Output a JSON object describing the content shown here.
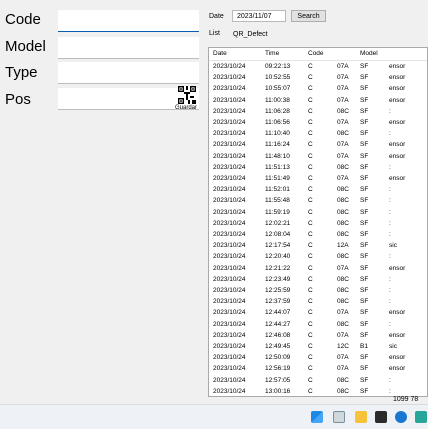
{
  "form": {
    "code_label": "Code",
    "model_label": "Model",
    "type_label": "Type",
    "pos_label": "Pos",
    "qr_caption": "Guardar"
  },
  "filter": {
    "date_label": "Date",
    "date_value": "2023/11/07",
    "search_label": "Search",
    "list_label": "List",
    "list_value": "QR_Defect"
  },
  "table": {
    "columns": [
      "Date",
      "Time",
      "Code",
      "Model"
    ],
    "rows": [
      [
        "2023/10/24",
        "09:22:13",
        "C",
        "07A",
        "SF",
        "ensor"
      ],
      [
        "2023/10/24",
        "10:52:55",
        "C",
        "07A",
        "SF",
        "ensor"
      ],
      [
        "2023/10/24",
        "10:55:07",
        "C",
        "07A",
        "SF",
        "ensor"
      ],
      [
        "2023/10/24",
        "11:00:38",
        "C",
        "07A",
        "SF",
        "ensor"
      ],
      [
        "2023/10/24",
        "11:06:28",
        "C",
        "08C",
        "SF",
        ":"
      ],
      [
        "2023/10/24",
        "11:06:56",
        "C",
        "07A",
        "SF",
        "ensor"
      ],
      [
        "2023/10/24",
        "11:10:40",
        "C",
        "08C",
        "SF",
        ":"
      ],
      [
        "2023/10/24",
        "11:16:24",
        "C",
        "07A",
        "SF",
        "ensor"
      ],
      [
        "2023/10/24",
        "11:48:10",
        "C",
        "07A",
        "SF",
        "ensor"
      ],
      [
        "2023/10/24",
        "11:51:13",
        "C",
        "08C",
        "SF",
        ":"
      ],
      [
        "2023/10/24",
        "11:51:49",
        "C",
        "07A",
        "SF",
        "ensor"
      ],
      [
        "2023/10/24",
        "11:52:01",
        "C",
        "08C",
        "SF",
        ":"
      ],
      [
        "2023/10/24",
        "11:55:48",
        "C",
        "08C",
        "SF",
        ":"
      ],
      [
        "2023/10/24",
        "11:59:19",
        "C",
        "08C",
        "SF",
        ":"
      ],
      [
        "2023/10/24",
        "12:02:21",
        "C",
        "08C",
        "SF",
        ":"
      ],
      [
        "2023/10/24",
        "12:08:04",
        "C",
        "08C",
        "SF",
        ":"
      ],
      [
        "2023/10/24",
        "12:17:54",
        "C",
        "12A",
        "SF",
        "sic"
      ],
      [
        "2023/10/24",
        "12:20:40",
        "C",
        "08C",
        "SF",
        ":"
      ],
      [
        "2023/10/24",
        "12:21:22",
        "C",
        "07A",
        "SF",
        "ensor"
      ],
      [
        "2023/10/24",
        "12:23:49",
        "C",
        "08C",
        "SF",
        ":"
      ],
      [
        "2023/10/24",
        "12:25:59",
        "C",
        "08C",
        "SF",
        ":"
      ],
      [
        "2023/10/24",
        "12:37:59",
        "C",
        "08C",
        "SF",
        ":"
      ],
      [
        "2023/10/24",
        "12:44:07",
        "C",
        "07A",
        "SF",
        "ensor"
      ],
      [
        "2023/10/24",
        "12:44:27",
        "C",
        "08C",
        "SF",
        ":"
      ],
      [
        "2023/10/24",
        "12:46:08",
        "C",
        "07A",
        "SF",
        "ensor"
      ],
      [
        "2023/10/24",
        "12:49:45",
        "C",
        "12C",
        "B1",
        "sic"
      ],
      [
        "2023/10/24",
        "12:50:09",
        "C",
        "07A",
        "SF",
        "ensor"
      ],
      [
        "2023/10/24",
        "12:56:19",
        "C",
        "07A",
        "SF",
        "ensor"
      ],
      [
        "2023/10/24",
        "12:57:05",
        "C",
        "08C",
        "SF",
        ":"
      ],
      [
        "2023/10/24",
        "13:00:16",
        "C",
        "08C",
        "SF",
        ":"
      ]
    ]
  },
  "status": {
    "count": "1099 78"
  },
  "taskbar": {
    "icons": [
      "windows-icon",
      "task-view-icon",
      "file-explorer-icon",
      "terminal-icon",
      "edge-icon",
      "store-icon"
    ]
  }
}
